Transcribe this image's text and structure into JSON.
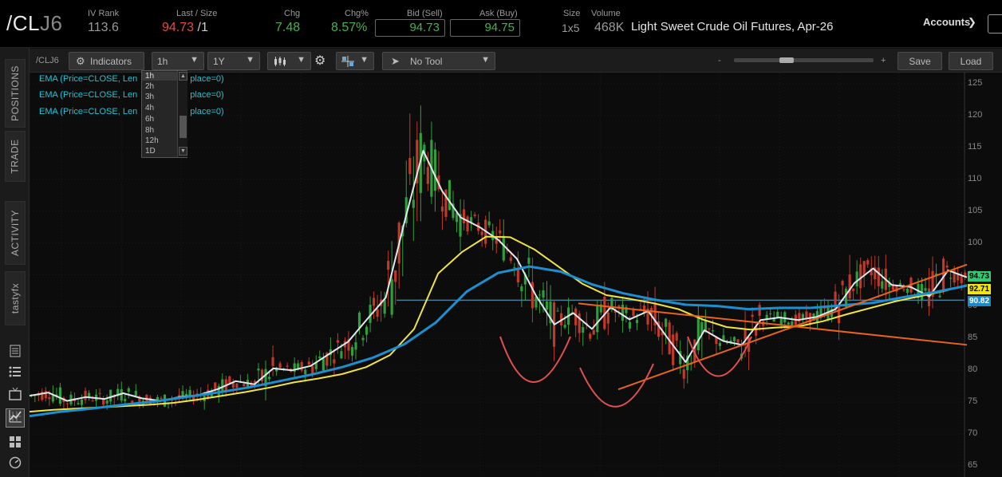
{
  "header": {
    "symbol_main": "/CL",
    "symbol_suffix": "J6",
    "iv_rank_label": "IV Rank",
    "iv_rank_value": "113.6",
    "last_size_label": "Last / Size",
    "last_value": "94.73",
    "last_size": "/1",
    "chg_label": "Chg",
    "chg_value": "7.48",
    "chgpct_label": "Chg%",
    "chgpct_value": "8.57%",
    "bid_label": "Bid (Sell)",
    "bid_value": "94.73",
    "ask_label": "Ask (Buy)",
    "ask_value": "94.75",
    "size_label": "Size",
    "size_value": "1x5",
    "volume_label": "Volume",
    "volume_value": "468K",
    "description": "Light Sweet Crude Oil Futures, Apr-26",
    "accounts_label": "Accounts"
  },
  "sidebar": {
    "tabs": [
      "POSITIONS",
      "TRADE",
      "ACTIVITY",
      "tastyfx"
    ]
  },
  "toolbar": {
    "symbol": "/CLJ6",
    "indicators_label": "Indicators",
    "interval": "1h",
    "range": "1Y",
    "drawing_tool": "No Tool",
    "zoom_minus": "-",
    "zoom_plus": "+",
    "save_label": "Save",
    "load_label": "Load"
  },
  "interval_dropdown": {
    "options": [
      "1h",
      "2h",
      "3h",
      "4h",
      "6h",
      "8h",
      "12h",
      "1D"
    ],
    "selected": "1h"
  },
  "legend": [
    "EMA (Price=CLOSE, Len",
    "EMA (Price=CLOSE, Len",
    "EMA (Price=CLOSE, Len"
  ],
  "legend_suffix": [
    "place=0)",
    "place=0)",
    "place=0)"
  ],
  "chart_data": {
    "type": "line",
    "title": "",
    "y_axis": {
      "min": 65,
      "max": 125,
      "ticks": [
        65,
        70,
        75,
        80,
        85,
        90,
        95,
        100,
        105,
        110,
        115,
        120,
        125
      ]
    },
    "price_labels": [
      {
        "value": 94.73,
        "color": "#2ecc71"
      },
      {
        "value": 92.71,
        "color": "#f2e600"
      },
      {
        "value": 90.82,
        "color": "#1e88c8"
      }
    ],
    "horizontal_line": 91.0,
    "series": [
      {
        "color": "#dfe8ee",
        "values": [
          76.0,
          76.5,
          75.2,
          75.8,
          75.5,
          76.4,
          75.6,
          75.2,
          75.8,
          76.1,
          77.0,
          78.3,
          77.8,
          80.3,
          80.0,
          80.7,
          82.6,
          84.5,
          88.0,
          91.4,
          103.3,
          114.5,
          108.2,
          104.0,
          102.5,
          100.5,
          97.5,
          91.8,
          87.2,
          89.0,
          86.5,
          89.9,
          88.0,
          89.3,
          85.2,
          81.3,
          86.3,
          84.6,
          84.0,
          87.9,
          88.3,
          87.9,
          88.4,
          89.6,
          93.7,
          96.0,
          93.4,
          93.1,
          91.6,
          95.7,
          94.6
        ]
      },
      {
        "color": "#f0e442",
        "values": [
          73.5,
          73.8,
          74.0,
          74.2,
          74.4,
          74.6,
          74.9,
          75.4,
          76.0,
          76.6,
          77.3,
          78.1,
          78.7,
          79.4,
          80.5,
          82.4,
          86.5,
          95.2,
          98.6,
          101.0,
          100.9,
          99.0,
          96.3,
          93.6,
          91.8,
          91.2,
          90.5,
          89.6,
          88.0,
          86.8,
          86.4,
          86.7,
          86.9,
          87.7,
          88.8,
          89.8,
          90.8,
          91.6,
          92.4,
          93.4
        ]
      },
      {
        "color": "#1d8fcf",
        "values": [
          72.8,
          73.5,
          74.0,
          74.6,
          75.1,
          75.8,
          76.5,
          77.3,
          78.3,
          79.3,
          80.5,
          82.0,
          84.1,
          87.5,
          92.4,
          95.3,
          96.3,
          95.5,
          93.5,
          92.1,
          91.1,
          90.3,
          90.1,
          89.6,
          89.8,
          89.8,
          90.2,
          90.6,
          91.5,
          92.3,
          93.3
        ]
      }
    ]
  }
}
